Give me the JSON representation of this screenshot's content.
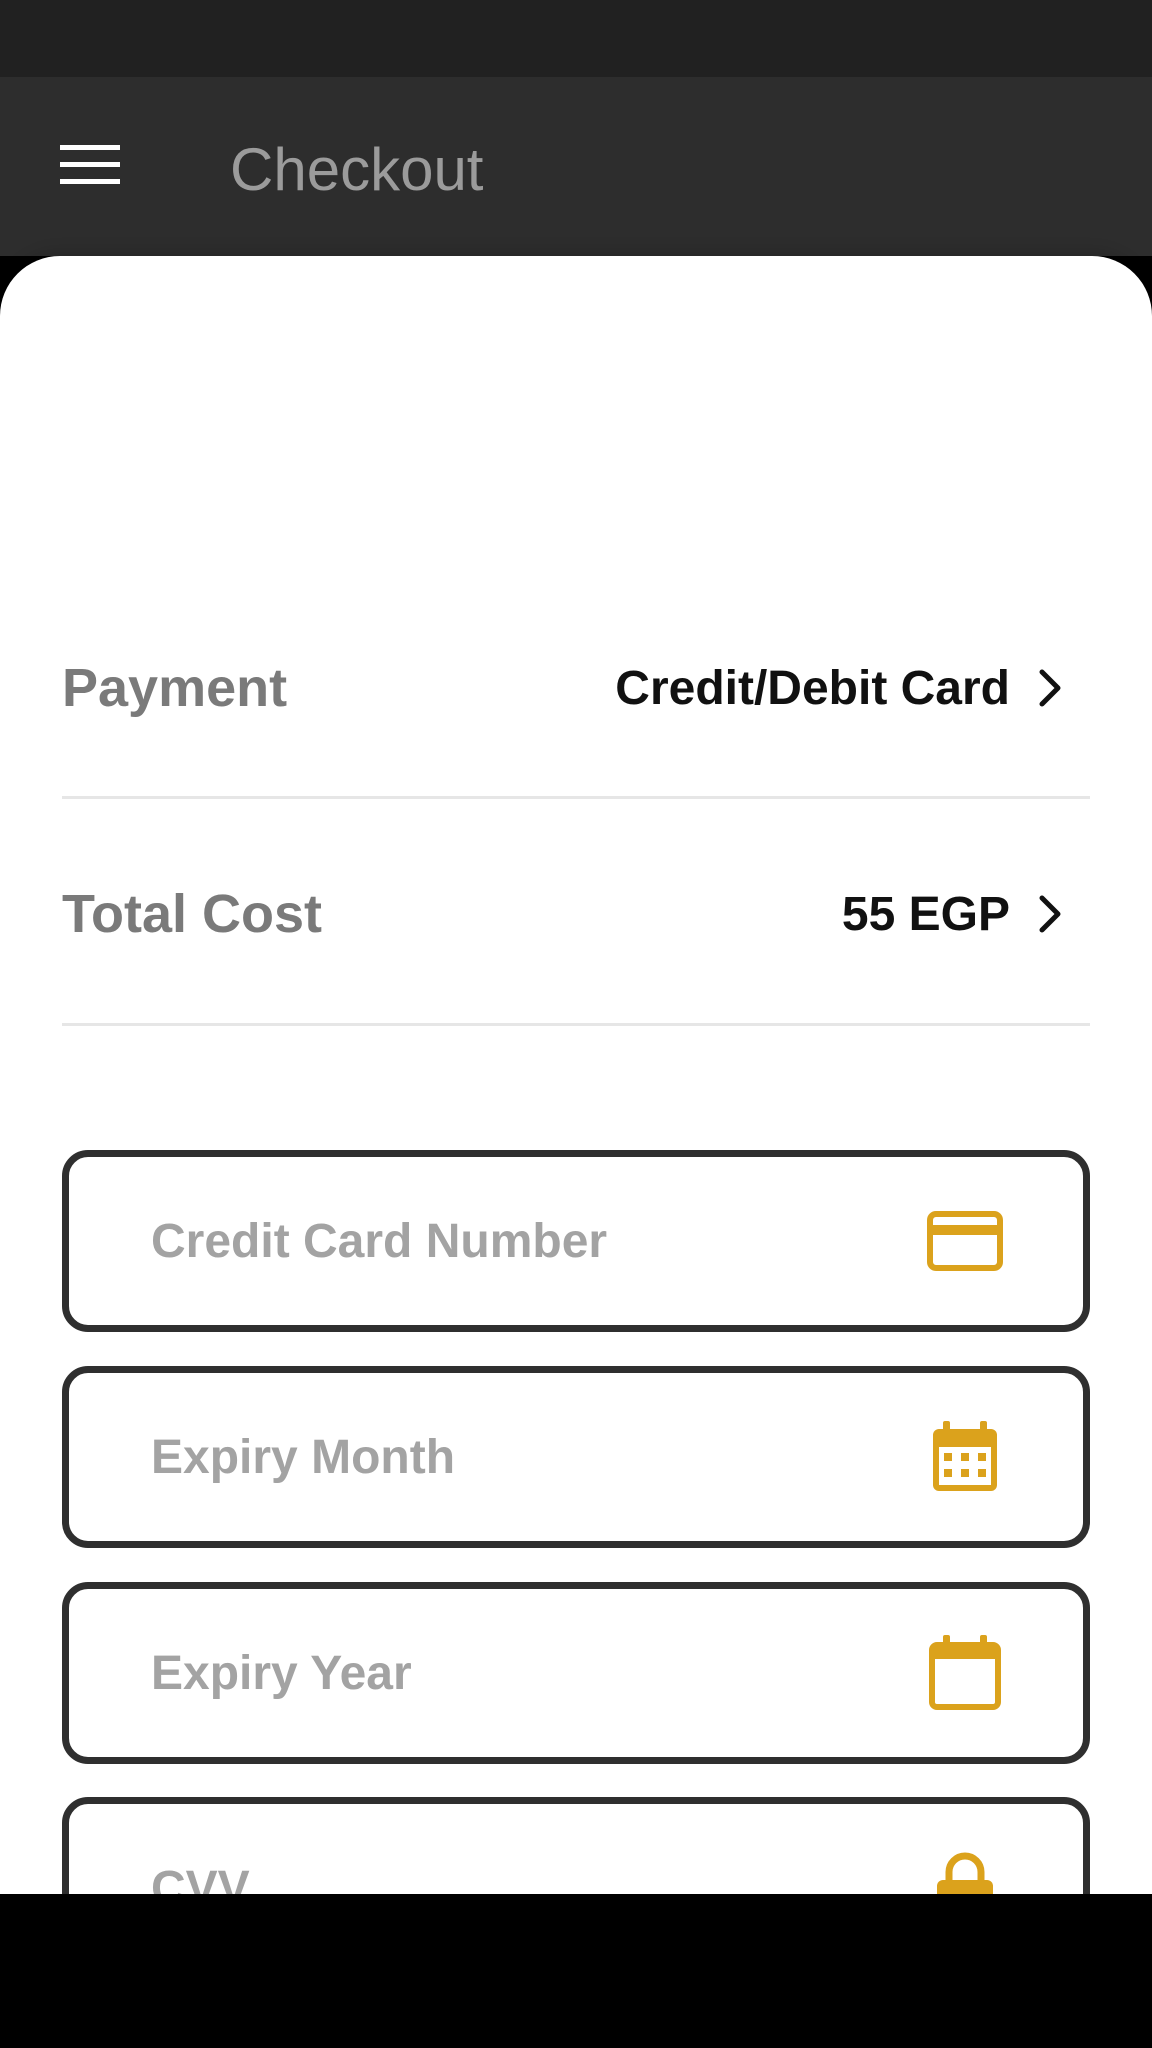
{
  "app_bar": {
    "title": "Checkout",
    "menu_icon": "hamburger-menu-icon"
  },
  "summary": {
    "payment": {
      "label": "Payment",
      "value": "Credit/Debit Card",
      "icon": "chevron-right-icon"
    },
    "total_cost": {
      "label": "Total Cost",
      "value": "55 EGP",
      "icon": "chevron-right-icon"
    }
  },
  "form": {
    "card_number": {
      "placeholder": "Credit Card Number",
      "value": "",
      "icon": "credit-card-icon"
    },
    "expiry_month": {
      "placeholder": "Expiry Month",
      "value": "",
      "icon": "calendar-month-icon"
    },
    "expiry_year": {
      "placeholder": "Expiry Year",
      "value": "",
      "icon": "calendar-icon"
    },
    "cvv": {
      "placeholder": "CVV",
      "value": "",
      "icon": "lock-icon"
    }
  },
  "colors": {
    "accent": "#dba21c",
    "app_bar": "#2d2d2d",
    "status_bar": "#212121",
    "field_border": "#2f2f2f"
  }
}
